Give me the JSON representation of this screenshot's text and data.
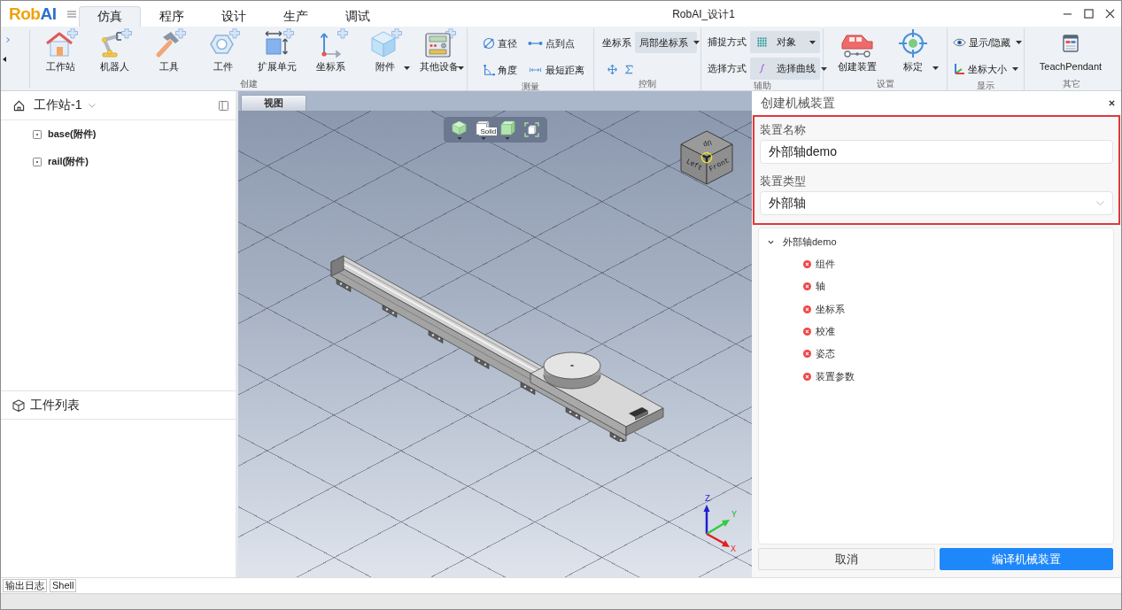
{
  "window": {
    "logo": [
      "Rob",
      "AI"
    ],
    "title": "RobAI_设计1"
  },
  "tabs": [
    {
      "label": "仿真",
      "selected": true
    },
    {
      "label": "程序",
      "selected": false
    },
    {
      "label": "设计",
      "selected": false
    },
    {
      "label": "生产",
      "selected": false
    },
    {
      "label": "调试",
      "selected": false
    }
  ],
  "ribbon": [
    {
      "label": "创建",
      "kind": "large",
      "items": [
        {
          "label": "工作站",
          "dropdown": false
        },
        {
          "label": "机器人",
          "dropdown": false
        },
        {
          "label": "工具",
          "dropdown": false
        },
        {
          "label": "工件",
          "dropdown": false
        },
        {
          "label": "扩展单元",
          "dropdown": false
        },
        {
          "label": "坐标系",
          "dropdown": false
        },
        {
          "label": "附件",
          "dropdown": true
        },
        {
          "label": "其他设备",
          "dropdown": true
        }
      ]
    },
    {
      "label": "测量",
      "kind": "grid",
      "items": [
        {
          "label": "直径",
          "dropdown": false
        },
        {
          "label": "点到点",
          "dropdown": false
        },
        {
          "label": "角度",
          "dropdown": false
        },
        {
          "label": "最短距离",
          "dropdown": false
        }
      ]
    },
    {
      "label": "控制",
      "kind": "control",
      "field": {
        "label": "坐标系",
        "value": "局部坐标系"
      }
    },
    {
      "label": "辅助",
      "kind": "selects",
      "rows": [
        {
          "label": "捕捉方式",
          "value": "对象"
        },
        {
          "label": "选择方式",
          "value": "选择曲线"
        }
      ]
    },
    {
      "label": "设置",
      "kind": "large",
      "items": [
        {
          "label": "创建装置",
          "dropdown": false
        },
        {
          "label": "标定",
          "dropdown": true
        }
      ]
    },
    {
      "label": "显示",
      "kind": "stack",
      "items": [
        {
          "label": "显示/隐藏",
          "dropdown": true
        },
        {
          "label": "坐标大小",
          "dropdown": true
        }
      ]
    },
    {
      "label": "其它",
      "kind": "large",
      "items": [
        {
          "label": "TeachPendant",
          "dropdown": false
        }
      ]
    }
  ],
  "workstation": {
    "title": "工作站-1",
    "items": [
      {
        "label": "base(附件)"
      },
      {
        "label": "rail(附件)"
      }
    ]
  },
  "parts_list": {
    "title": "工件列表"
  },
  "viewport": {
    "tab": "视图",
    "toolbar": [
      {
        "dropdown": true
      },
      {
        "dropdown": true,
        "label": "Solid"
      },
      {
        "dropdown": true
      },
      {
        "dropdown": false
      }
    ],
    "view_cube": [
      "Up",
      "Left",
      "Front"
    ],
    "axis_labels": [
      "Z",
      "Y",
      "X"
    ]
  },
  "device_panel": {
    "title": "创建机械装置",
    "highlighted": true,
    "name_field": {
      "label": "装置名称",
      "value": "外部轴demo"
    },
    "type_field": {
      "label": "装置类型",
      "value": "外部轴"
    },
    "tree": {
      "label": "外部轴demo",
      "expanded": true,
      "children": [
        {
          "label": "组件",
          "error": true
        },
        {
          "label": "轴",
          "error": true
        },
        {
          "label": "坐标系",
          "error": true
        },
        {
          "label": "校准",
          "error": true
        },
        {
          "label": "姿态",
          "error": true
        },
        {
          "label": "装置参数",
          "error": true
        }
      ]
    },
    "buttons": [
      {
        "label": "取消",
        "kind": "secondary"
      },
      {
        "label": "编译机械装置",
        "kind": "primary"
      }
    ]
  },
  "bottom_tabs": [
    {
      "label": "输出日志"
    },
    {
      "label": "Shell"
    }
  ]
}
